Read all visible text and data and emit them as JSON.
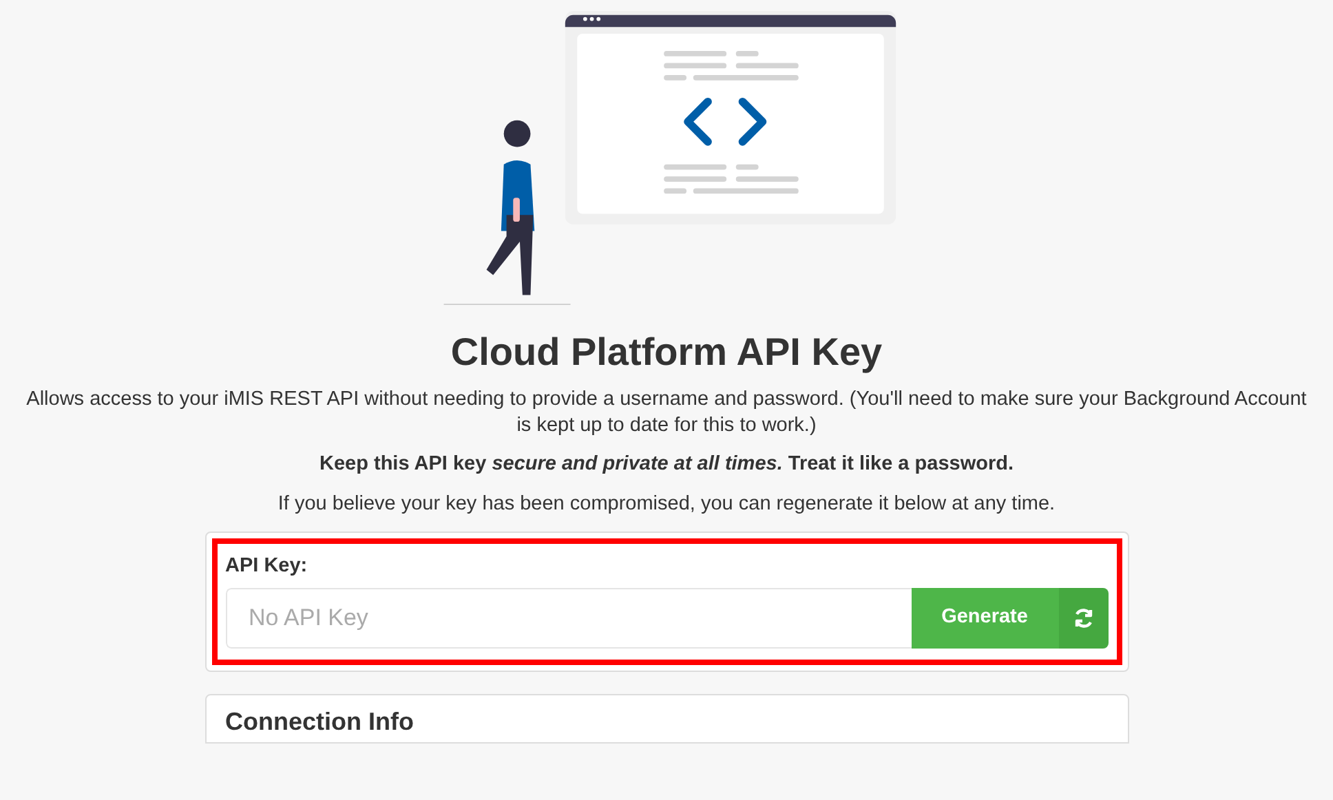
{
  "title": "Cloud Platform API Key",
  "description": "Allows access to your iMIS REST API without needing to provide a username and password. (You'll need to make sure your Background Account is kept up to date for this to work.)",
  "warning": "Keep this API key *secure and private at all times.* Treat it like a password.",
  "note": "If you believe your key has been compromised, you can regenerate it below at any time.",
  "api_key": {
    "label": "API Key:",
    "placeholder": "No API Key",
    "button": "Generate"
  },
  "connection_info": {
    "title": "Connection Info"
  }
}
